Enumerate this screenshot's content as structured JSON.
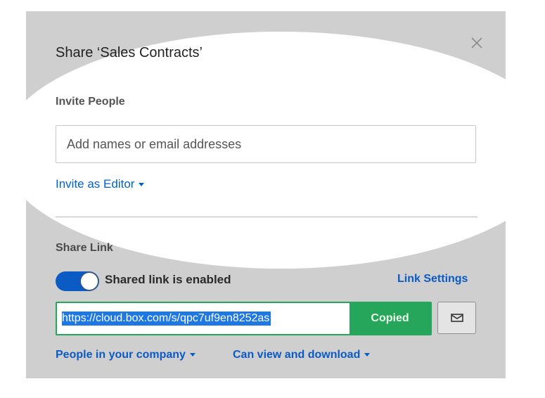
{
  "dialog": {
    "title": "Share ‘Sales Contracts’"
  },
  "invite": {
    "label": "Invite People",
    "placeholder": "Add names or email addresses",
    "role_label": "Invite as Editor"
  },
  "share_link": {
    "label": "Share Link",
    "toggle_enabled": true,
    "toggle_text": "Shared link is enabled",
    "settings_label": "Link Settings",
    "url": "https://cloud.box.com/s/qpc7uf9en8252as",
    "copy_button_label": "Copied",
    "audience_label": "People in your company",
    "permission_label": "Can view and download"
  },
  "icons": {
    "close": "close-icon",
    "email": "envelope-icon",
    "dropdown": "chevron-down-icon"
  },
  "colors": {
    "link_blue": "#0061d5",
    "toggle_blue": "#0a5bc4",
    "copied_green": "#26a65b",
    "panel_gray": "#cfcfcf"
  }
}
